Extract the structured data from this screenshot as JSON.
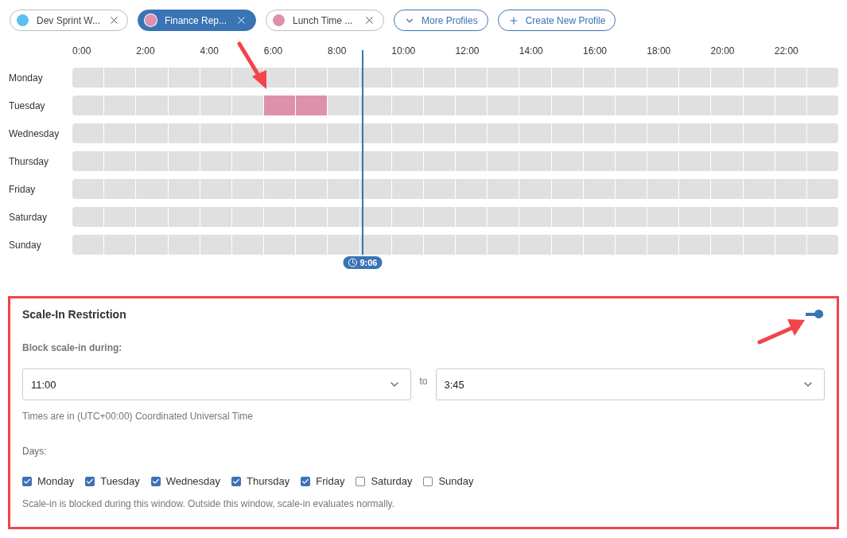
{
  "profiles": [
    {
      "label": "Dev Sprint W...",
      "color": "#5bc0f0",
      "selected": false
    },
    {
      "label": "Finance Rep...",
      "color": "#dd91ab",
      "selected": true
    },
    {
      "label": "Lunch Time ...",
      "color": "#dd91ab",
      "selected": false
    }
  ],
  "actions": [
    {
      "kind": "dropdown",
      "label": "More Profiles"
    },
    {
      "kind": "create",
      "label": "Create New Profile"
    }
  ],
  "schedule": {
    "hours": [
      "0:00",
      "2:00",
      "4:00",
      "6:00",
      "8:00",
      "10:00",
      "12:00",
      "14:00",
      "16:00",
      "18:00",
      "20:00",
      "22:00"
    ],
    "days": [
      {
        "name": "Monday",
        "filled_hours": [
          false,
          false,
          false,
          false,
          false,
          false,
          false,
          false,
          false,
          false,
          false,
          false,
          false,
          false,
          false,
          false,
          false,
          false,
          false,
          false,
          false,
          false,
          false,
          false
        ]
      },
      {
        "name": "Tuesday",
        "filled_hours": [
          false,
          false,
          false,
          false,
          false,
          false,
          true,
          true,
          false,
          false,
          false,
          false,
          false,
          false,
          false,
          false,
          false,
          false,
          false,
          false,
          false,
          false,
          false,
          false
        ]
      },
      {
        "name": "Wednesday",
        "filled_hours": [
          false,
          false,
          false,
          false,
          false,
          false,
          false,
          false,
          false,
          false,
          false,
          false,
          false,
          false,
          false,
          false,
          false,
          false,
          false,
          false,
          false,
          false,
          false,
          false
        ]
      },
      {
        "name": "Thursday",
        "filled_hours": [
          false,
          false,
          false,
          false,
          false,
          false,
          false,
          false,
          false,
          false,
          false,
          false,
          false,
          false,
          false,
          false,
          false,
          false,
          false,
          false,
          false,
          false,
          false,
          false
        ]
      },
      {
        "name": "Friday",
        "filled_hours": [
          false,
          false,
          false,
          false,
          false,
          false,
          false,
          false,
          false,
          false,
          false,
          false,
          false,
          false,
          false,
          false,
          false,
          false,
          false,
          false,
          false,
          false,
          false,
          false
        ]
      },
      {
        "name": "Saturday",
        "filled_hours": [
          false,
          false,
          false,
          false,
          false,
          false,
          false,
          false,
          false,
          false,
          false,
          false,
          false,
          false,
          false,
          false,
          false,
          false,
          false,
          false,
          false,
          false,
          false,
          false
        ]
      },
      {
        "name": "Sunday",
        "filled_hours": [
          false,
          false,
          false,
          false,
          false,
          false,
          false,
          false,
          false,
          false,
          false,
          false,
          false,
          false,
          false,
          false,
          false,
          false,
          false,
          false,
          false,
          false,
          false,
          false
        ]
      }
    ],
    "now": {
      "label": "9:06",
      "level": 0.379
    }
  },
  "restriction": {
    "title": "Scale-In Restriction",
    "enabled": true,
    "block_label": "Block scale-in during:",
    "from": {
      "value": "11:00"
    },
    "to_label": "to",
    "to": {
      "value": "3:45"
    },
    "timezone_note": "Times are in (UTC+00:00) Coordinated Universal Time",
    "days_label": "Days:",
    "days": [
      {
        "label": "Monday",
        "checked": true
      },
      {
        "label": "Tuesday",
        "checked": true
      },
      {
        "label": "Wednesday",
        "checked": true
      },
      {
        "label": "Thursday",
        "checked": true
      },
      {
        "label": "Friday",
        "checked": true
      },
      {
        "label": "Saturday",
        "checked": false
      },
      {
        "label": "Sunday",
        "checked": false
      }
    ],
    "footnote": "Scale-in is blocked during this window. Outside this window, scale-in evaluates normally."
  }
}
